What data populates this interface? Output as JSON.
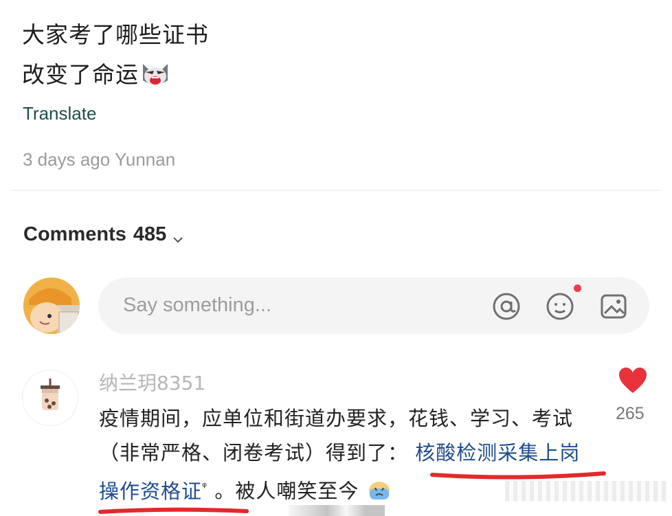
{
  "post": {
    "title_line1": "大家考了哪些证书",
    "title_line2": "改变了命运",
    "title_emoji": "screaming-cat-emoji",
    "translate_label": "Translate",
    "meta": "3 days ago Yunnan"
  },
  "comments_header": {
    "label": "Comments",
    "count": "485",
    "chevron_icon": "chevron-down-icon"
  },
  "composer": {
    "placeholder": "Say something...",
    "icons": [
      "at-icon",
      "emoji-icon",
      "image-icon"
    ],
    "notification_dot_color": "#ef3a4f"
  },
  "comment": {
    "username": "纳兰玥8351",
    "text_part1": "疫情期间，应单位和街道办要求，花钱、学习、考试（非常严格、闭卷考试）得到了：",
    "highlight_text": "核酸检测采集上岗操作资格证",
    "search_mark": "ᵠ",
    "text_part2": "。被人嘲笑至今",
    "trailing_emoji": "crying-face-emoji",
    "likes": "265",
    "like_icon": "heart-icon",
    "like_color": "#e8323c"
  },
  "colors": {
    "translate": "#1d4e4a",
    "meta": "#9a9a9a",
    "highlight": "#1f4c8f",
    "underline": "#e02b2b"
  }
}
